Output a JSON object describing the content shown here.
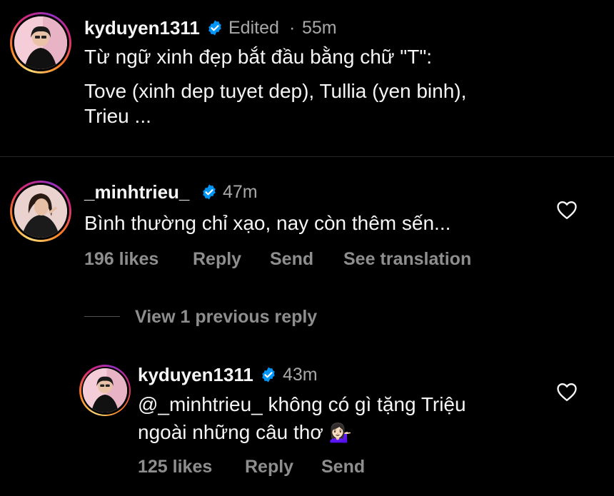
{
  "caption": {
    "username": "kyduyen1311",
    "edited": "Edited",
    "dot": "·",
    "time": "55m",
    "line1": "Từ ngữ xinh đẹp bắt đầu bằng chữ \"T\":",
    "line2": "Tove (xinh dep tuyet dep), Tullia (yen binh),",
    "line3": "Trieu ..."
  },
  "comment": {
    "username": "_minhtrieu_",
    "time": "47m",
    "text": "Bình thường chỉ xạo, nay còn thêm sến...",
    "likes": "196 likes",
    "reply": "Reply",
    "send": "Send",
    "see_translation": "See translation"
  },
  "view_replies": "View 1 previous reply",
  "reply": {
    "username": "kyduyen1311",
    "time": "43m",
    "line1": "@_minhtrieu_ không có gì tặng Triệu",
    "line2": "ngoài những câu thơ",
    "emoji": "💁🏻‍♀️",
    "likes": "125 likes",
    "reply": "Reply",
    "send": "Send"
  },
  "colors": {
    "background": "#000000",
    "text": "#f5f5f5",
    "secondary": "#a8a8a8",
    "verified": "#0095f6"
  }
}
